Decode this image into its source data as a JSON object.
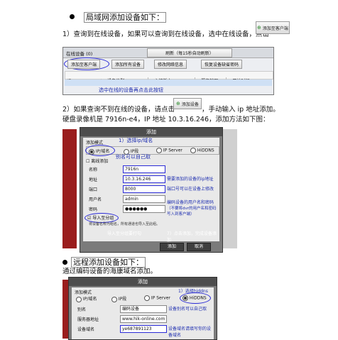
{
  "section1": {
    "heading": "局域网添加设备如下：",
    "para": "1）查询到在线设备，如果可以查询到在线设备，选中在线设备，点击",
    "inline_button": "添加至客户端"
  },
  "shot1": {
    "online_label": "在线设备 (0)",
    "refresh_label": "刷新（每15秒自动刷新）",
    "buttons": [
      "添加至客户端",
      "添加所有设备",
      "修改网络信息",
      "恢复设备缺省密码"
    ],
    "columns": [
      "IP",
      "设备类型",
      "主控版本",
      "服务端口",
      "开始时间"
    ],
    "note": "选中在线的设备再点击此按钮"
  },
  "section2": {
    "para_a": "2）如果查询不到在线的设备，请点击",
    "inline_button": "添加设备",
    "para_b": "，手动输入 ip 地址添加。",
    "para_c": "硬盘录像机是 7916n-e4，IP 地址 10.3.16.246，添加方法如下图："
  },
  "dialog1": {
    "title": "添加",
    "annot_choose_ip": "1）选择ip/域名",
    "mode_label": "添加模式",
    "modes": [
      "IP/域名",
      "IP段",
      "IP Server",
      "HiDDNS"
    ],
    "annot_name": "别名可以自己取",
    "sync_label": "离线添加",
    "fields": [
      {
        "label": "名称",
        "value": "7916n"
      },
      {
        "label": "地址",
        "value": "10.3.16.246"
      },
      {
        "label": "端口",
        "value": "8000"
      },
      {
        "label": "用户名",
        "value": "admin"
      },
      {
        "label": "密码",
        "value": "●●●●●●"
      }
    ],
    "annot_ip": "需要添加的设备的ip地址",
    "annot_port": "端口号可以在设备上修改",
    "annot_pwd": "编码设备的用户名和密码",
    "annot_pwd2": "（不要将dvr的用户名和密码写入到客户端）",
    "import_label": "导入至分组",
    "import_hint": "将设备名称为组名，所有通道也导入至此组。",
    "annot_import": "导入至分组要打勾",
    "annot_confirm": "7）点击添加，完成设备添加",
    "ok": "添加",
    "cancel": "取消"
  },
  "section3": {
    "heading": "远程添加设备如下：",
    "para": "通过编码设备的海康域名添加。"
  },
  "dialog2": {
    "title": "添加",
    "annot_choose": "1）选择hiddns",
    "mode_label": "添加模式",
    "modes": [
      "IP/域名",
      "IP段",
      "IP Server",
      "HiDDNS"
    ],
    "fields": [
      {
        "label": "别名",
        "value": "编码设备"
      },
      {
        "label": "服务器地址",
        "value": "www.hik-online.com"
      },
      {
        "label": "设备域名",
        "value": "ye687891123"
      }
    ],
    "annot_name": "设备别名可以自己取",
    "annot_domain": "设备域名请填写你的设备域名"
  }
}
